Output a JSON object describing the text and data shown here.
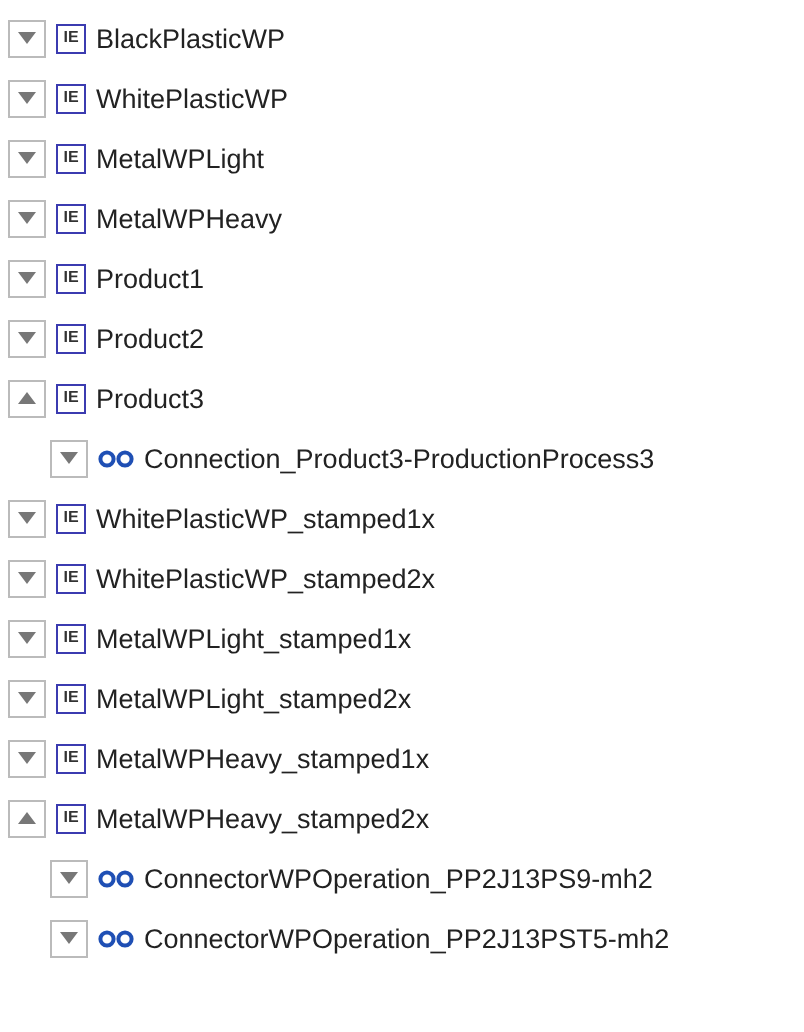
{
  "tree": [
    {
      "kind": "element",
      "badge": "IE",
      "label": "BlackPlasticWP",
      "expanded": false
    },
    {
      "kind": "element",
      "badge": "IE",
      "label": "WhitePlasticWP",
      "expanded": false
    },
    {
      "kind": "element",
      "badge": "IE",
      "label": "MetalWPLight",
      "expanded": false
    },
    {
      "kind": "element",
      "badge": "IE",
      "label": "MetalWPHeavy",
      "expanded": false
    },
    {
      "kind": "element",
      "badge": "IE",
      "label": "Product1",
      "expanded": false
    },
    {
      "kind": "element",
      "badge": "IE",
      "label": "Product2",
      "expanded": false
    },
    {
      "kind": "element",
      "badge": "IE",
      "label": "Product3",
      "expanded": true,
      "children": [
        {
          "kind": "connection",
          "label": "Connection_Product3-ProductionProcess3",
          "expanded": false
        }
      ]
    },
    {
      "kind": "element",
      "badge": "IE",
      "label": "WhitePlasticWP_stamped1x",
      "expanded": false
    },
    {
      "kind": "element",
      "badge": "IE",
      "label": "WhitePlasticWP_stamped2x",
      "expanded": false
    },
    {
      "kind": "element",
      "badge": "IE",
      "label": "MetalWPLight_stamped1x",
      "expanded": false
    },
    {
      "kind": "element",
      "badge": "IE",
      "label": "MetalWPLight_stamped2x",
      "expanded": false
    },
    {
      "kind": "element",
      "badge": "IE",
      "label": "MetalWPHeavy_stamped1x",
      "expanded": false
    },
    {
      "kind": "element",
      "badge": "IE",
      "label": "MetalWPHeavy_stamped2x",
      "expanded": true,
      "children": [
        {
          "kind": "connection",
          "label": "ConnectorWPOperation_PP2J13PS9-mh2",
          "expanded": false
        },
        {
          "kind": "connection",
          "label": "ConnectorWPOperation_PP2J13PST5-mh2",
          "expanded": false
        }
      ]
    }
  ]
}
